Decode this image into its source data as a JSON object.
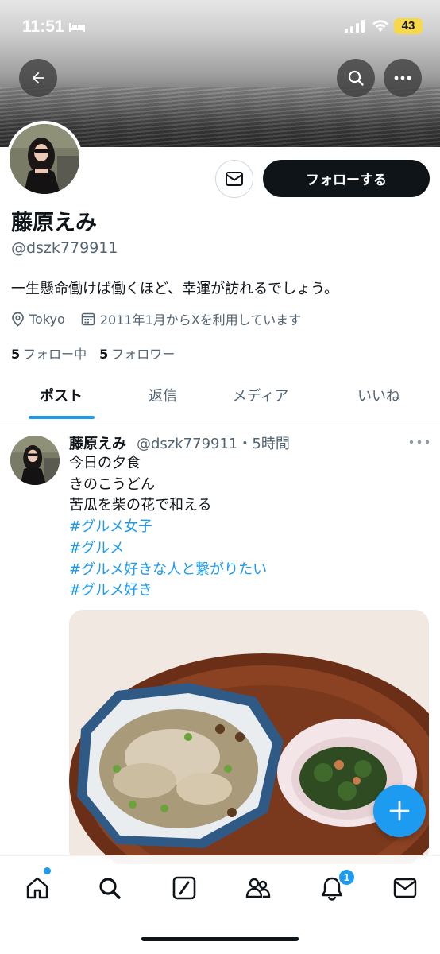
{
  "status_bar": {
    "time": "11:51",
    "battery": "43"
  },
  "profile": {
    "display_name": "藤原えみ",
    "handle": "@dszk779911",
    "bio": "一生懸命働けば働くほど、幸運が訪れるでしょう。",
    "location": "Tokyo",
    "joined": "2011年1月からXを利用しています",
    "following_count": "5",
    "following_label": "フォロー中",
    "followers_count": "5",
    "followers_label": "フォロワー",
    "follow_button": "フォローする"
  },
  "tabs": [
    {
      "label": "ポスト",
      "active": true
    },
    {
      "label": "返信",
      "active": false
    },
    {
      "label": "メディア",
      "active": false
    },
    {
      "label": "いいね",
      "active": false
    }
  ],
  "post": {
    "author": "藤原えみ",
    "meta": "@dszk779911・5時間",
    "lines": [
      "今日の夕食",
      "きのこうどん",
      "苦瓜を柴の花で和える"
    ],
    "hashtags": [
      "#グルメ女子",
      "#グルメ",
      "#グルメ好きな人と繋がりたい",
      "#グルメ好き"
    ]
  },
  "bottom_nav": {
    "items": [
      "home-icon",
      "search-icon",
      "grok-icon",
      "communities-icon",
      "notifications-icon",
      "messages-icon"
    ],
    "notification_count": "1"
  },
  "colors": {
    "accent": "#1d9bf0",
    "text": "#0f1419",
    "secondary": "#536471"
  }
}
